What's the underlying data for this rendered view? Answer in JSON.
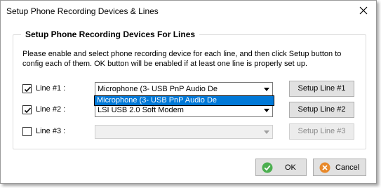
{
  "window": {
    "title": "Setup Phone Recording Devices & Lines",
    "close_icon": "close-icon"
  },
  "group": {
    "legend": "Setup Phone Recording Devices For Lines",
    "description": "Please enable and select phone recording device for each line, and then click Setup button to config each of them. OK button will be enabled if at least one line is properly set up."
  },
  "lines": [
    {
      "label": "Line #1 :",
      "checked": true,
      "device": "Microphone (3- USB PnP Audio De",
      "button": "Setup Line #1",
      "enabled": true
    },
    {
      "label": "Line #2 :",
      "checked": true,
      "device": "LSI USB 2.0 Soft Modem",
      "button": "Setup Line #2",
      "enabled": true
    },
    {
      "label": "Line #3 :",
      "checked": false,
      "device": "",
      "button": "Setup Line #3",
      "enabled": false
    }
  ],
  "dropdown": {
    "items": [
      "Microphone (3- USB PnP Audio De"
    ]
  },
  "buttons": {
    "ok_label": "OK",
    "ok_icon": "check-circle-icon",
    "cancel_label": "Cancel",
    "cancel_icon": "cancel-circle-icon"
  },
  "colors": {
    "selection": "#0078d7",
    "ok_icon": "#4caf50",
    "cancel_icon": "#e8892a"
  }
}
